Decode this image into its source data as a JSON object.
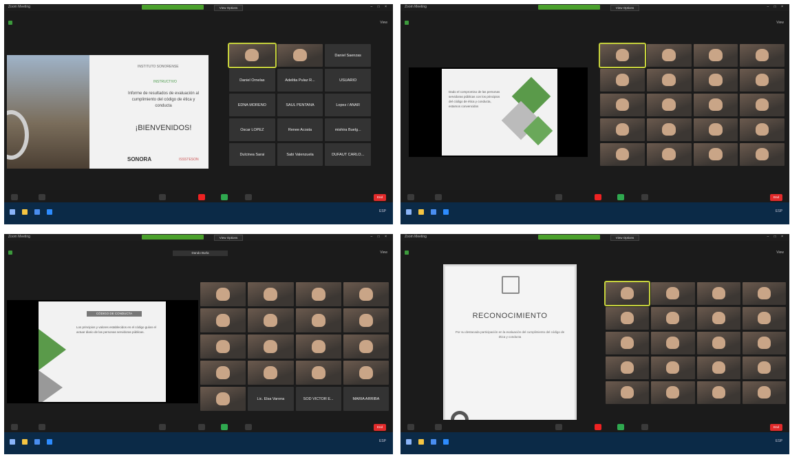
{
  "app_title": "Zoom Meeting",
  "view_button": "View Options",
  "window_controls": "– □ ×",
  "view_label": "View",
  "end_label": "End",
  "tray_text": "ESP",
  "panels": [
    {
      "slide": {
        "heading": "INSTITUTO SONORENSE",
        "label": "INSTRUCTIVO",
        "body": "Informe de resultados de evaluación al cumplimiento del código de ética y conducta",
        "welcome": "¡BIENVENIDOS!",
        "footer_left": "SONORA",
        "footer_right": "ISSSTESON"
      },
      "participants": [
        "Daniel Saenzas",
        "Daniel Ornelas",
        "Adelitia Pulaz R...",
        "USUARIO",
        "EDNA MORENO",
        "SAUL PENTANA",
        "Lopez / ANAR",
        "Oscar LOPEZ",
        "Renee Acosta",
        "mishira Buelg...",
        "Dulcinea Sarai",
        "Sabi Valenzuela",
        "DUFAUT CARLO..."
      ]
    },
    {
      "slide": {
        "body": "Dado el compromiso de las personas servidoras públicas con los principios del código de ética y conducta, estamos convencidos"
      }
    },
    {
      "center_label": "Dando Burla",
      "slide": {
        "heading": "CÓDIGO DE CONDUCTA",
        "body": "Los principios y valores establecidos en el código guían el actuar diario de las personas servidoras públicas."
      },
      "participants": [
        "Lic. Elsa Varona",
        "SOD VICTOR E...",
        "MARIA ARRIBA"
      ]
    },
    {
      "slide": {
        "heading": "RECONOCIMIENTO",
        "body": "Por su destacada participación en la evaluación del cumplimiento del código de ética y conducta"
      }
    }
  ]
}
